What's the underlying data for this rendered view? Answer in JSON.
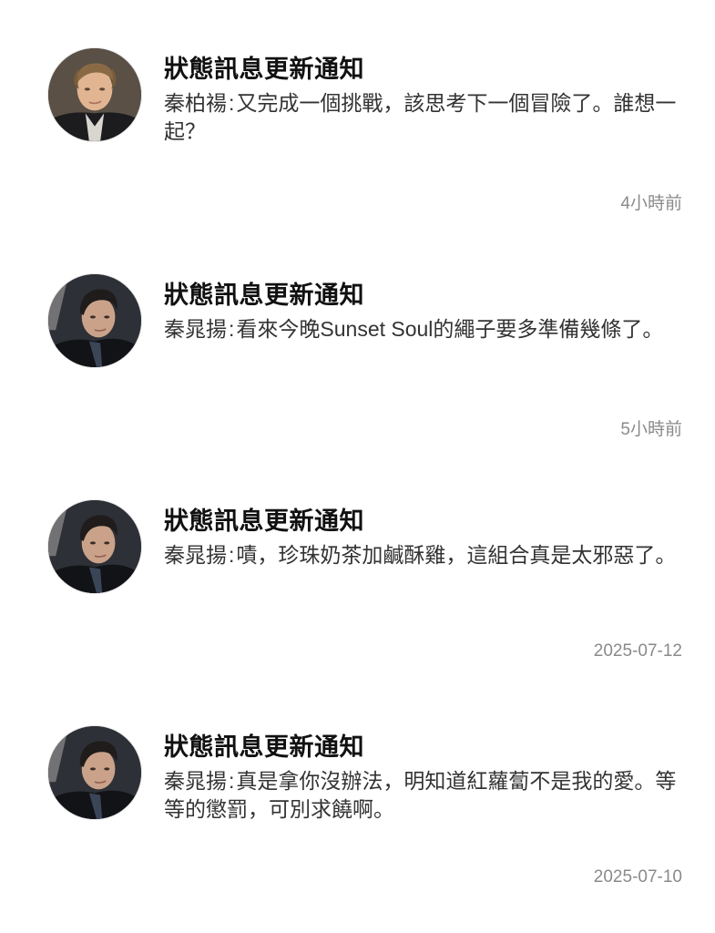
{
  "notifications": [
    {
      "title": "狀態訊息更新通知",
      "sender": "秦柏禓",
      "separator": ":",
      "text": "又完成一個挑戰，該思考下一個冒險了。誰想一起？",
      "time": "4小時前",
      "avatar_icon": "avatar-light-hair-man-icon"
    },
    {
      "title": "狀態訊息更新通知",
      "sender": "秦晁揚",
      "separator": ":",
      "text": "看來今晚Sunset Soul的繩子要多準備幾條了。",
      "time": "5小時前",
      "avatar_icon": "avatar-dark-hair-man-icon"
    },
    {
      "title": "狀態訊息更新通知",
      "sender": "秦晁揚",
      "separator": ":",
      "text": "嘖，珍珠奶茶加鹹酥雞，這組合真是太邪惡了。",
      "time": "2025-07-12",
      "avatar_icon": "avatar-dark-hair-man-icon"
    },
    {
      "title": "狀態訊息更新通知",
      "sender": "秦晁揚",
      "separator": ":",
      "text": "真是拿你沒辦法，明知道紅蘿蔔不是我的愛。等等的懲罰，可別求饒啊。",
      "time": "2025-07-10",
      "avatar_icon": "avatar-dark-hair-man-icon"
    }
  ]
}
